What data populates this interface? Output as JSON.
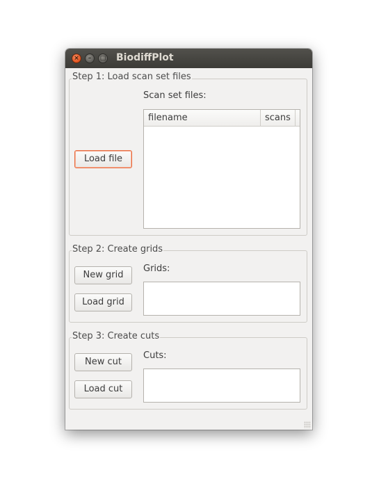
{
  "window": {
    "title": "BiodiffPlot",
    "controls": {
      "close_glyph": "×",
      "minimize_glyph": "–",
      "maximize_glyph": "□"
    }
  },
  "step1": {
    "title": "Step 1: Load scan set files",
    "load_button": "Load file",
    "list_label": "Scan set files:",
    "columns": [
      "filename",
      "scans"
    ],
    "rows": []
  },
  "step2": {
    "title": "Step 2: Create grids",
    "new_button": "New grid",
    "load_button": "Load grid",
    "list_label": "Grids:",
    "items": []
  },
  "step3": {
    "title": "Step 3: Create cuts",
    "new_button": "New cut",
    "load_button": "Load cut",
    "list_label": "Cuts:",
    "items": []
  },
  "colors": {
    "focus_accent": "#e86b3e",
    "close_button": "#e2521d",
    "titlebar": "#3c3b37",
    "window_bg": "#f2f1f0"
  }
}
